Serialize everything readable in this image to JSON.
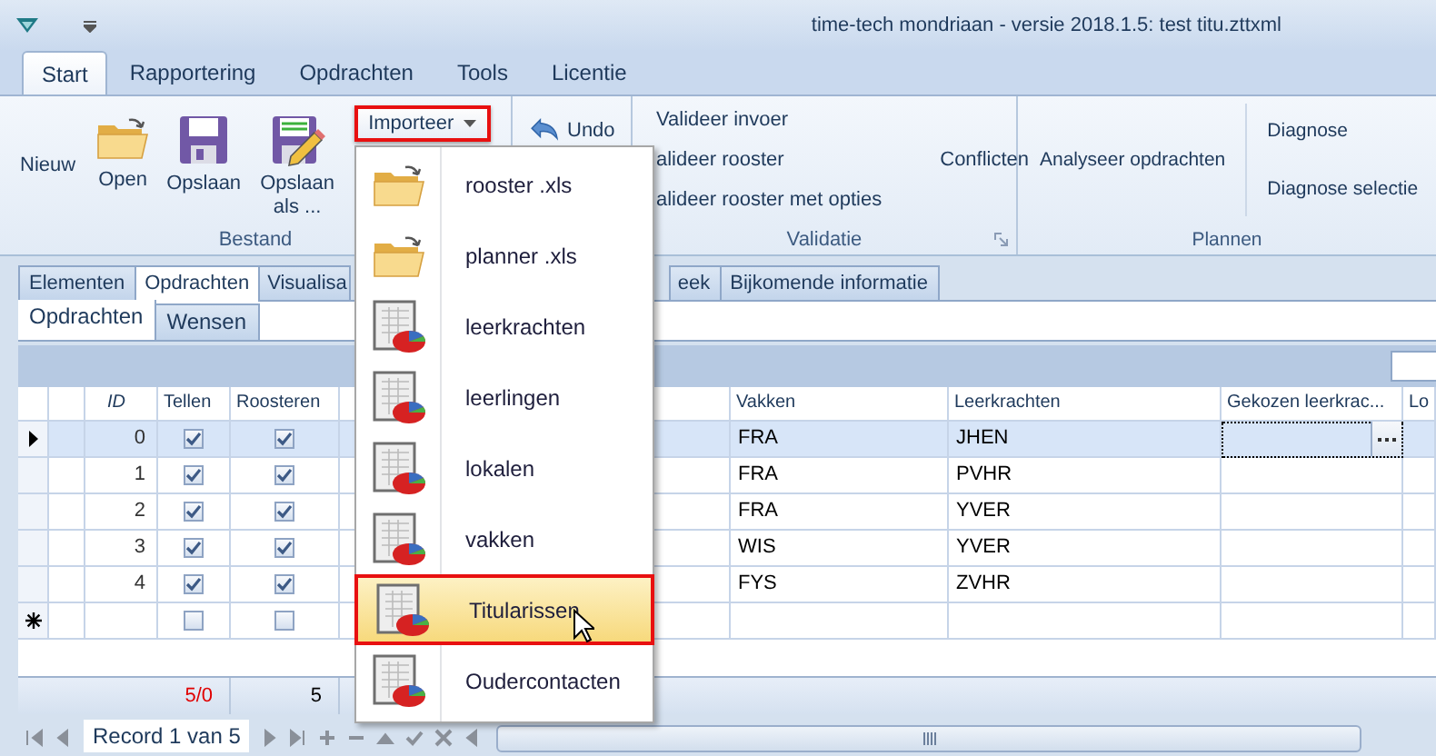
{
  "window": {
    "title": "time-tech mondriaan - versie 2018.1.5: test titu.zttxml"
  },
  "ribbon": {
    "tabs": [
      {
        "label": "Start",
        "selected": true
      },
      {
        "label": "Rapportering",
        "selected": false
      },
      {
        "label": "Opdrachten",
        "selected": false
      },
      {
        "label": "Tools",
        "selected": false
      },
      {
        "label": "Licentie",
        "selected": false
      }
    ],
    "groups": [
      {
        "kind": "bestand",
        "label": "Bestand",
        "buttons": [
          "Nieuw",
          "Open",
          "Opslaan",
          "Opslaan als ..."
        ],
        "dropdown": {
          "label": "Importeer",
          "expanded": true
        }
      },
      {
        "kind": "edit",
        "buttons": [
          "Undo"
        ]
      },
      {
        "kind": "validatie",
        "label": "Validatie",
        "items": [
          "Valideer invoer",
          "alideer rooster",
          "alideer rooster met opties"
        ],
        "side": "Conflicten"
      },
      {
        "kind": "plannen",
        "label": "Plannen",
        "main": "Analyseer opdrachten",
        "items": [
          "Diagnose",
          "Diagnose selectie"
        ]
      }
    ]
  },
  "doc_tabs": [
    {
      "label": "Elementen",
      "selected": false
    },
    {
      "label": "Opdrachten",
      "selected": true
    },
    {
      "label": "Visualisa",
      "selected": false
    },
    {
      "label": "eek",
      "selected": false
    },
    {
      "label": "Bijkomende informatie",
      "selected": false
    }
  ],
  "sub_tabs": [
    {
      "label": "Opdrachten",
      "selected": true
    },
    {
      "label": "Wensen",
      "selected": false
    }
  ],
  "grid": {
    "columns": [
      "ID",
      "Tellen",
      "Roosteren",
      "Vakken",
      "Leerkrachten",
      "Gekozen leerkrac...",
      "Lo"
    ],
    "rows": [
      {
        "id": "0",
        "tellen": true,
        "roosteren": true,
        "vakken": "FRA",
        "leerkrachten": "JHEN",
        "selected": true
      },
      {
        "id": "1",
        "tellen": true,
        "roosteren": true,
        "vakken": "FRA",
        "leerkrachten": "PVHR",
        "selected": false
      },
      {
        "id": "2",
        "tellen": true,
        "roosteren": true,
        "vakken": "FRA",
        "leerkrachten": "YVER",
        "selected": false
      },
      {
        "id": "3",
        "tellen": true,
        "roosteren": true,
        "vakken": "WIS",
        "leerkrachten": "YVER",
        "selected": false
      },
      {
        "id": "4",
        "tellen": true,
        "roosteren": true,
        "vakken": "FYS",
        "leerkrachten": "ZVHR",
        "selected": false
      }
    ],
    "new_row": {
      "tellen": false,
      "roosteren": false
    },
    "footer": {
      "tellen": "5/0",
      "roosteren": "5"
    }
  },
  "navigator": {
    "record": "Record 1 van 5"
  },
  "import_menu": {
    "items": [
      {
        "label": "rooster .xls",
        "selected": false
      },
      {
        "label": "planner .xls",
        "selected": false
      },
      {
        "label": "leerkrachten",
        "selected": false
      },
      {
        "label": "leerlingen",
        "selected": false
      },
      {
        "label": "lokalen",
        "selected": false
      },
      {
        "label": "vakken",
        "selected": false
      },
      {
        "label": "Titularissen",
        "selected": true
      },
      {
        "label": "Oudercontacten",
        "selected": false
      }
    ]
  }
}
